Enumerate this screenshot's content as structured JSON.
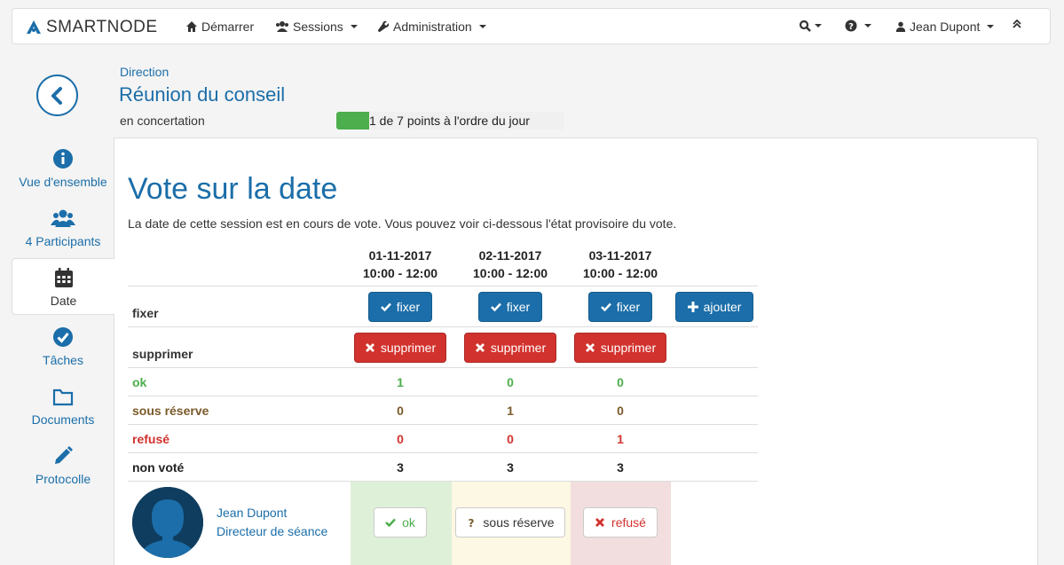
{
  "navbar": {
    "brand": "SMARTNODE",
    "start": "Démarrer",
    "sessions": "Sessions",
    "administration": "Administration",
    "user": "Jean Dupont"
  },
  "header": {
    "parent": "Direction",
    "title": "Réunion du conseil",
    "status": "en concertation",
    "progress_text": "1 de 7 points à l'ordre du jour",
    "progress_fraction": 0.143,
    "progress_color": "#4cae4c"
  },
  "sidebar": {
    "items": [
      {
        "label": "Vue d'ensemble",
        "icon": "info-icon"
      },
      {
        "label": "4 Participants",
        "icon": "users-icon"
      },
      {
        "label": "Date",
        "icon": "calendar-icon"
      },
      {
        "label": "Tâches",
        "icon": "check-circle-icon"
      },
      {
        "label": "Documents",
        "icon": "folder-icon"
      },
      {
        "label": "Protocolle",
        "icon": "pencil-icon"
      }
    ]
  },
  "main": {
    "title": "Vote sur la date",
    "description": "La date de cette session est en cours de vote. Vous pouvez voir ci-dessous l'état provisoire du vote.",
    "dates": [
      {
        "date": "01-11-2017",
        "time": "10:00 - 12:00"
      },
      {
        "date": "02-11-2017",
        "time": "10:00 - 12:00"
      },
      {
        "date": "03-11-2017",
        "time": "10:00 - 12:00"
      }
    ],
    "row_labels": {
      "fix": "fixer",
      "delete": "supprimer",
      "ok": "ok",
      "reserve": "sous réserve",
      "refused": "refusé",
      "not_voted": "non voté"
    },
    "buttons": {
      "fix": "fixer",
      "delete": "supprimer",
      "add": "ajouter"
    },
    "counts": {
      "ok": [
        "1",
        "0",
        "0"
      ],
      "reserve": [
        "0",
        "1",
        "0"
      ],
      "refused": [
        "0",
        "0",
        "1"
      ],
      "not_voted": [
        "3",
        "3",
        "3"
      ]
    },
    "participant": {
      "name": "Jean Dupont",
      "role": "Directeur de séance"
    },
    "vote_buttons": {
      "ok": "ok",
      "reserve": "sous réserve",
      "refused": "refusé"
    }
  }
}
